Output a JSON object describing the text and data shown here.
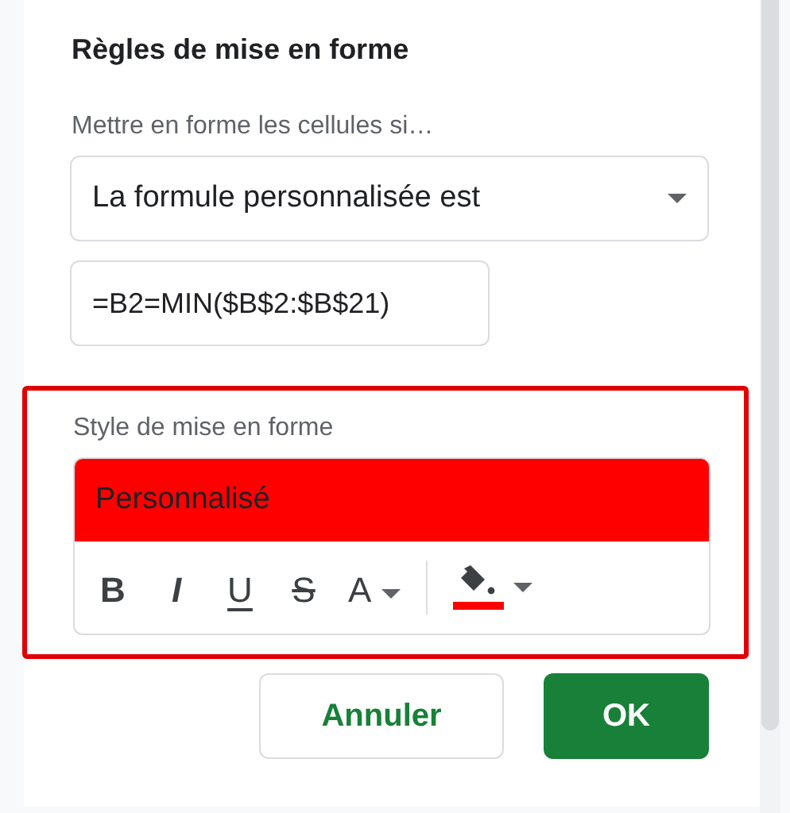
{
  "panel": {
    "title": "Règles de mise en forme",
    "condition_label": "Mettre en forme les cellules si…",
    "condition_dropdown": {
      "value": "La formule personnalisée est"
    },
    "formula_field": {
      "value": "=B2=MIN($B$2:$B$21)"
    },
    "style_section": {
      "highlighted": true,
      "label": "Style de mise en forme",
      "preview": {
        "text": "Personnalisé",
        "color": "#ff0000"
      },
      "toolbar": [
        {
          "kind": "bold",
          "label": "B"
        },
        {
          "kind": "italic",
          "label": "I"
        },
        {
          "kind": "underline",
          "label": "U"
        },
        {
          "kind": "strike",
          "label": "S"
        },
        {
          "kind": "text_color",
          "label": "A"
        },
        {
          "kind": "fill_color",
          "color": "#ff0000"
        }
      ]
    },
    "buttons": [
      {
        "label": "Annuler",
        "kind": "secondary"
      },
      {
        "label": "OK",
        "kind": "primary"
      }
    ]
  }
}
